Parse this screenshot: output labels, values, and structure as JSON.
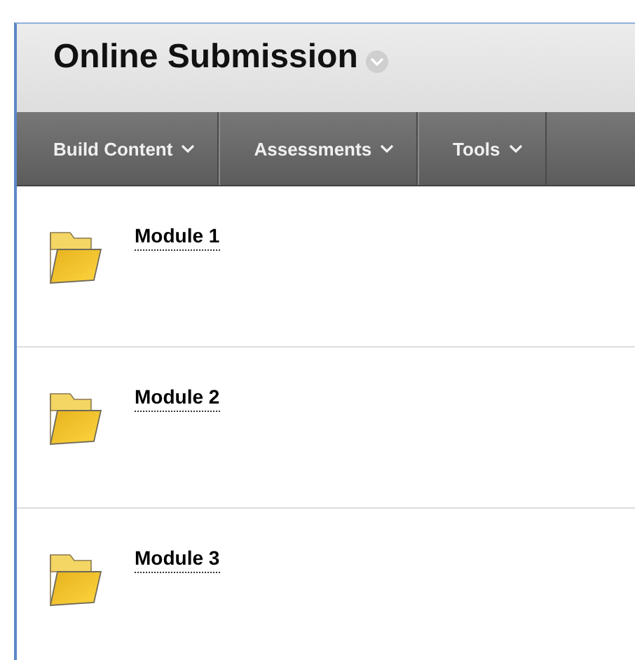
{
  "page_title": {
    "text": "Online Submission"
  },
  "menu_bar": [
    {
      "label": "Build Content"
    },
    {
      "label": "Assessments"
    },
    {
      "label": "Tools"
    }
  ],
  "content_items": [
    {
      "title": "Module 1"
    },
    {
      "title": "Module 2"
    },
    {
      "title": "Module 3"
    }
  ]
}
